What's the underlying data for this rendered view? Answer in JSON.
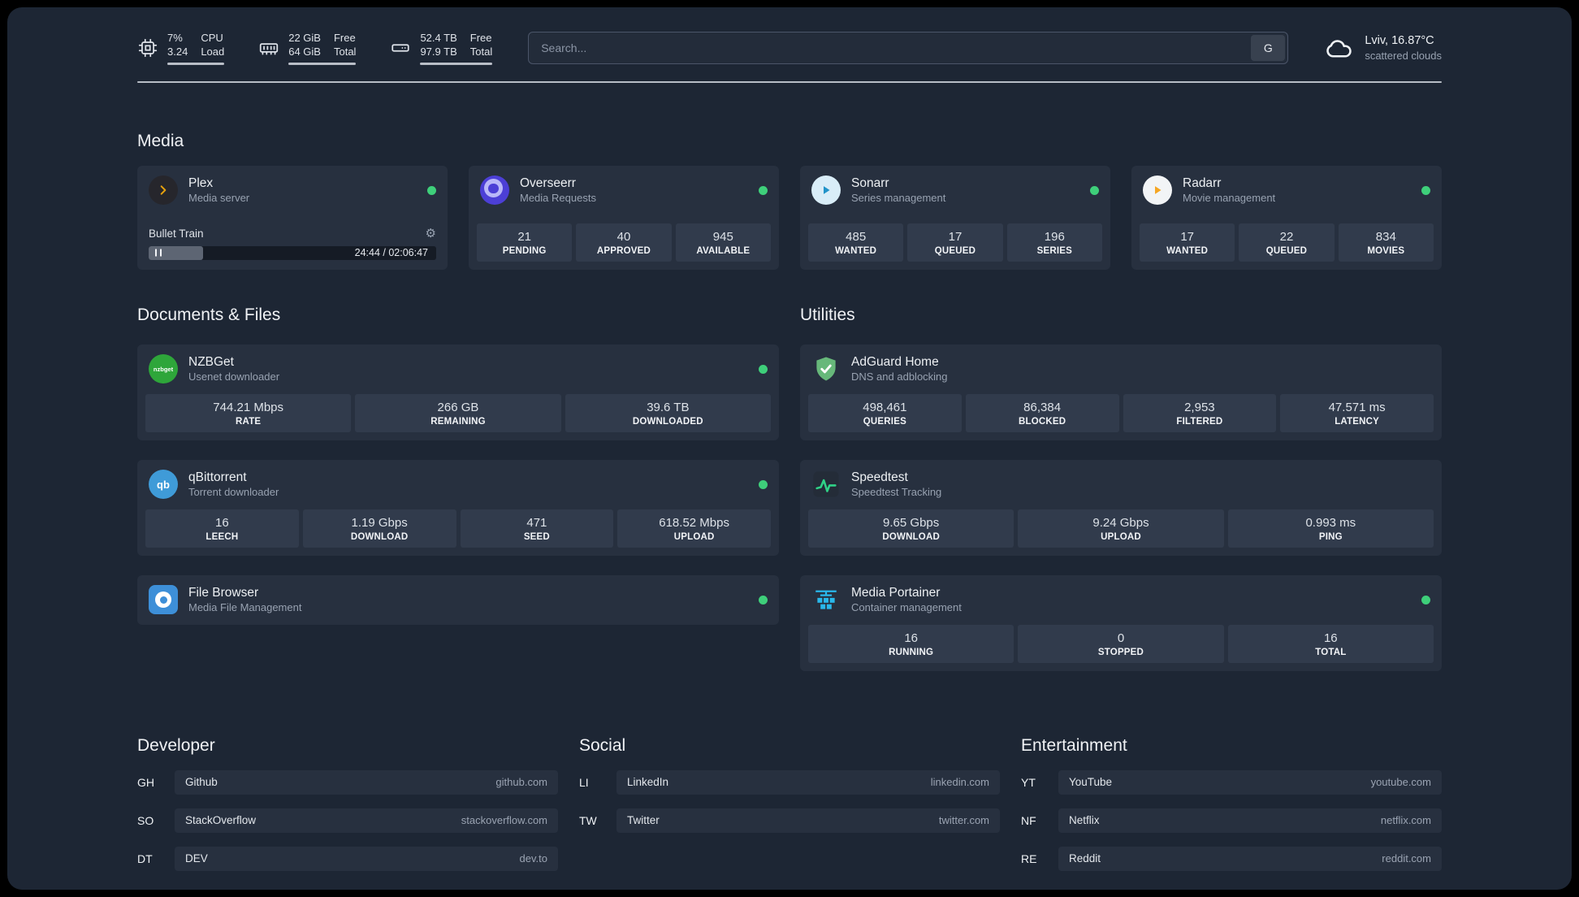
{
  "header": {
    "cpu": {
      "value1": "7%",
      "label1": "CPU",
      "value2": "3.24",
      "label2": "Load"
    },
    "memory": {
      "value1": "22 GiB",
      "label1": "Free",
      "value2": "64 GiB",
      "label2": "Total"
    },
    "disk": {
      "value1": "52.4 TB",
      "label1": "Free",
      "value2": "97.9 TB",
      "label2": "Total"
    },
    "search": {
      "placeholder": "Search...",
      "button_label": "G"
    },
    "weather": {
      "location": "Lviv, 16.87°C",
      "condition": "scattered clouds"
    }
  },
  "sections": {
    "media": "Media",
    "documents": "Documents & Files",
    "utilities": "Utilities",
    "developer": "Developer",
    "social": "Social",
    "entertainment": "Entertainment"
  },
  "apps": {
    "plex": {
      "name": "Plex",
      "subtitle": "Media server",
      "online": true,
      "player": {
        "title": "Bullet Train",
        "time": "24:44 / 02:06:47",
        "progress_style": "width:19%"
      }
    },
    "overseerr": {
      "name": "Overseerr",
      "subtitle": "Media Requests",
      "online": true,
      "stats": [
        {
          "value": "21",
          "label": "PENDING"
        },
        {
          "value": "40",
          "label": "APPROVED"
        },
        {
          "value": "945",
          "label": "AVAILABLE"
        }
      ]
    },
    "sonarr": {
      "name": "Sonarr",
      "subtitle": "Series management",
      "online": true,
      "stats": [
        {
          "value": "485",
          "label": "WANTED"
        },
        {
          "value": "17",
          "label": "QUEUED"
        },
        {
          "value": "196",
          "label": "SERIES"
        }
      ]
    },
    "radarr": {
      "name": "Radarr",
      "subtitle": "Movie management",
      "online": true,
      "stats": [
        {
          "value": "17",
          "label": "WANTED"
        },
        {
          "value": "22",
          "label": "QUEUED"
        },
        {
          "value": "834",
          "label": "MOVIES"
        }
      ]
    },
    "nzbget": {
      "name": "NZBGet",
      "subtitle": "Usenet downloader",
      "online": true,
      "icon_text": "nzbget",
      "stats": [
        {
          "value": "744.21 Mbps",
          "label": "RATE"
        },
        {
          "value": "266 GB",
          "label": "REMAINING"
        },
        {
          "value": "39.6 TB",
          "label": "DOWNLOADED"
        }
      ]
    },
    "qbittorrent": {
      "name": "qBittorrent",
      "subtitle": "Torrent downloader",
      "online": true,
      "icon_text": "qb",
      "stats": [
        {
          "value": "16",
          "label": "LEECH"
        },
        {
          "value": "1.19 Gbps",
          "label": "DOWNLOAD"
        },
        {
          "value": "471",
          "label": "SEED"
        },
        {
          "value": "618.52 Mbps",
          "label": "UPLOAD"
        }
      ]
    },
    "filebrowser": {
      "name": "File Browser",
      "subtitle": "Media File Management",
      "online": true
    },
    "adguard": {
      "name": "AdGuard Home",
      "subtitle": "DNS and adblocking",
      "stats": [
        {
          "value": "498,461",
          "label": "QUERIES"
        },
        {
          "value": "86,384",
          "label": "BLOCKED"
        },
        {
          "value": "2,953",
          "label": "FILTERED"
        },
        {
          "value": "47.571 ms",
          "label": "LATENCY"
        }
      ]
    },
    "speedtest": {
      "name": "Speedtest",
      "subtitle": "Speedtest Tracking",
      "stats": [
        {
          "value": "9.65 Gbps",
          "label": "DOWNLOAD"
        },
        {
          "value": "9.24 Gbps",
          "label": "UPLOAD"
        },
        {
          "value": "0.993 ms",
          "label": "PING"
        }
      ]
    },
    "portainer": {
      "name": "Media Portainer",
      "subtitle": "Container management",
      "online": true,
      "stats": [
        {
          "value": "16",
          "label": "RUNNING"
        },
        {
          "value": "0",
          "label": "STOPPED"
        },
        {
          "value": "16",
          "label": "TOTAL"
        }
      ]
    }
  },
  "bookmarks": {
    "developer": [
      {
        "abbr": "GH",
        "name": "Github",
        "url": "github.com"
      },
      {
        "abbr": "SO",
        "name": "StackOverflow",
        "url": "stackoverflow.com"
      },
      {
        "abbr": "DT",
        "name": "DEV",
        "url": "dev.to"
      }
    ],
    "social": [
      {
        "abbr": "LI",
        "name": "LinkedIn",
        "url": "linkedin.com"
      },
      {
        "abbr": "TW",
        "name": "Twitter",
        "url": "twitter.com"
      }
    ],
    "entertainment": [
      {
        "abbr": "YT",
        "name": "YouTube",
        "url": "youtube.com"
      },
      {
        "abbr": "NF",
        "name": "Netflix",
        "url": "netflix.com"
      },
      {
        "abbr": "RE",
        "name": "Reddit",
        "url": "reddit.com"
      }
    ]
  },
  "colors": {
    "background": "#1d2634",
    "card": "#27303f",
    "stat_box": "#313b4c",
    "status_online": "#3ecf7a",
    "plex_accent": "#e5a00d",
    "sonarr_accent": "#2193c9",
    "radarr_accent": "#f5a623",
    "adguard_accent": "#67b87a",
    "speedtest_accent": "#2fd387",
    "portainer_accent": "#29b8eb"
  }
}
